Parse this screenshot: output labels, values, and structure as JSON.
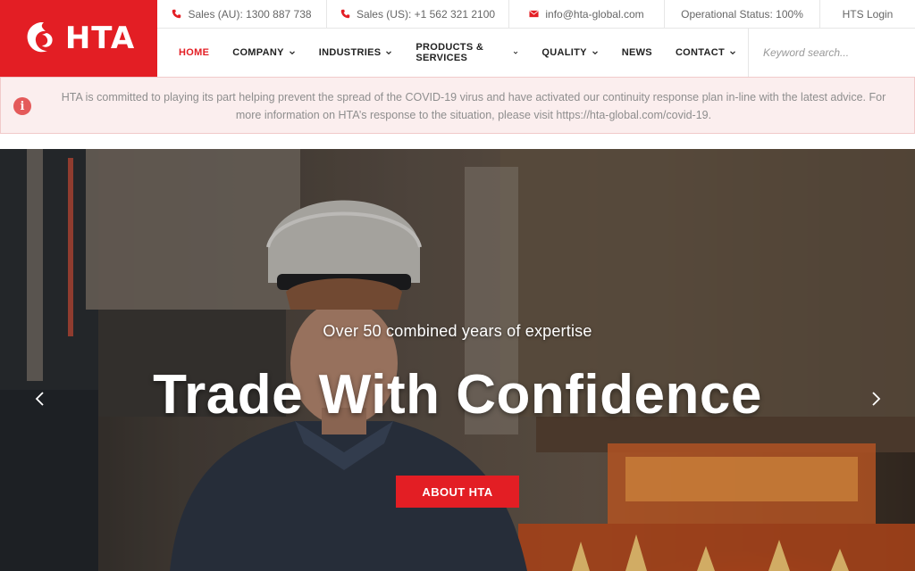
{
  "brand": {
    "name": "HTA",
    "color": "#e31e24",
    "logo_icon": "dragon-icon"
  },
  "topbar": {
    "items": [
      {
        "icon": "phone-icon",
        "label": "Sales (AU): 1300 887 738"
      },
      {
        "icon": "phone-icon",
        "label": "Sales (US): +1 562 321 2100"
      },
      {
        "icon": "mail-icon",
        "label": "info@hta-global.com"
      },
      {
        "label": "Operational Status: 100%"
      },
      {
        "label": "HTS Login"
      }
    ]
  },
  "nav": {
    "items": [
      {
        "label": "HOME",
        "active": true
      },
      {
        "label": "COMPANY",
        "dropdown": true
      },
      {
        "label": "INDUSTRIES",
        "dropdown": true
      },
      {
        "label": "PRODUCTS & SERVICES",
        "dropdown": true
      },
      {
        "label": "QUALITY",
        "dropdown": true
      },
      {
        "label": "NEWS"
      },
      {
        "label": "CONTACT",
        "dropdown": true
      }
    ],
    "search_placeholder": "Keyword search..."
  },
  "alert": {
    "icon": "info-icon",
    "text": "HTA is committed to playing its part helping prevent the spread of the COVID-19 virus and have activated our continuity response plan in-line with the latest advice. For more information on HTA’s response to the situation, please visit https://hta-global.com/covid-19."
  },
  "hero": {
    "subtitle": "Over 50 combined years of expertise",
    "title": "Trade With Confidence",
    "button_label": "ABOUT HTA",
    "prev_icon": "chevron-left-icon",
    "next_icon": "chevron-right-icon"
  }
}
